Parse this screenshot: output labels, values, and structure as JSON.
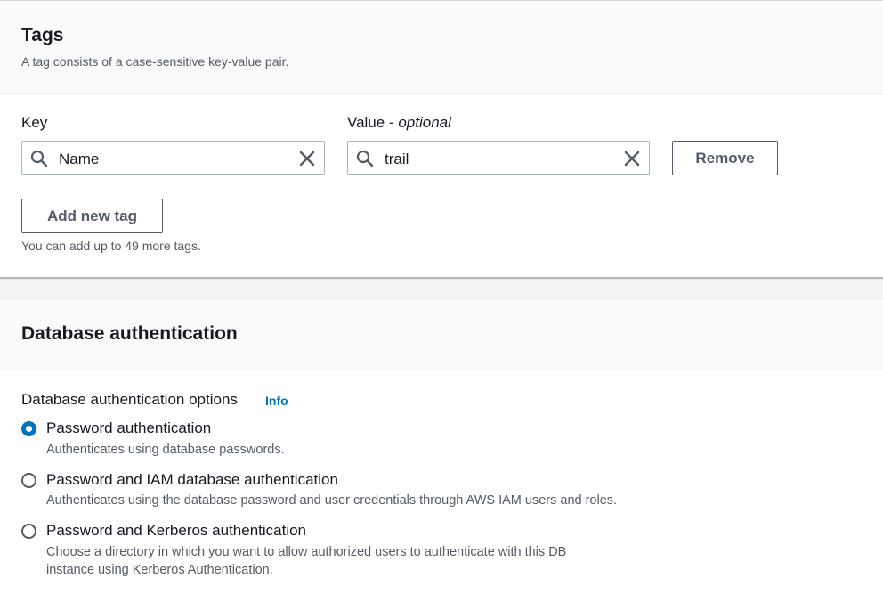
{
  "tags": {
    "title": "Tags",
    "description": "A tag consists of a case-sensitive key-value pair.",
    "key_label": "Key",
    "value_label_main": "Value - ",
    "value_label_optional": "optional",
    "rows": [
      {
        "key": "Name",
        "value": "trail",
        "remove_label": "Remove"
      }
    ],
    "add_label": "Add new tag",
    "limit_text": "You can add up to 49 more tags."
  },
  "db_auth": {
    "title": "Database authentication",
    "options_label": "Database authentication options",
    "info_label": "Info",
    "options": [
      {
        "title": "Password authentication",
        "description": "Authenticates using database passwords.",
        "selected": true
      },
      {
        "title": "Password and IAM database authentication",
        "description": "Authenticates using the database password and user credentials through AWS IAM users and roles.",
        "selected": false
      },
      {
        "title": "Password and Kerberos authentication",
        "description_line1": "Choose a directory in which you want to allow authorized users to authenticate with this DB",
        "description_line2": "instance using Kerberos Authentication.",
        "selected": false
      }
    ]
  },
  "colors": {
    "accent": "#0073bb",
    "text": "#16191f",
    "secondary": "#545b64",
    "border": "#aab7b8"
  },
  "icons": {
    "search": "search-icon",
    "clear": "close-icon"
  }
}
